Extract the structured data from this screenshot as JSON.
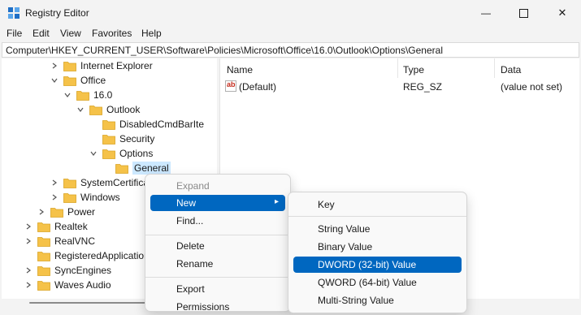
{
  "window": {
    "title": "Registry Editor",
    "minimize_glyph": "—",
    "close_glyph": "✕"
  },
  "menubar": [
    "File",
    "Edit",
    "View",
    "Favorites",
    "Help"
  ],
  "address": "Computer\\HKEY_CURRENT_USER\\Software\\Policies\\Microsoft\\Office\\16.0\\Outlook\\Options\\General",
  "tree": [
    {
      "label": "Internet Explorer",
      "expander": "collapsed"
    },
    {
      "label": "Office",
      "expander": "expanded"
    },
    {
      "label": "16.0",
      "expander": "expanded"
    },
    {
      "label": "Outlook",
      "expander": "expanded"
    },
    {
      "label": "DisabledCmdBarIte",
      "expander": "none"
    },
    {
      "label": "Security",
      "expander": "none"
    },
    {
      "label": "Options",
      "expander": "expanded"
    },
    {
      "label": "General",
      "expander": "none",
      "selected": true
    },
    {
      "label": "SystemCertificat",
      "expander": "collapsed"
    },
    {
      "label": "Windows",
      "expander": "collapsed"
    },
    {
      "label": "Power",
      "expander": "collapsed"
    },
    {
      "label": "Realtek",
      "expander": "collapsed"
    },
    {
      "label": "RealVNC",
      "expander": "collapsed"
    },
    {
      "label": "RegisteredApplication",
      "expander": "none"
    },
    {
      "label": "SyncEngines",
      "expander": "collapsed"
    },
    {
      "label": "Waves Audio",
      "expander": "collapsed"
    }
  ],
  "list": {
    "headers": {
      "name": "Name",
      "type": "Type",
      "data": "Data"
    },
    "rows": [
      {
        "icon": "string-value-icon",
        "icon_text": "ab",
        "name": "(Default)",
        "type": "REG_SZ",
        "data": "(value not set)"
      }
    ]
  },
  "context_menu": {
    "expand": "Expand",
    "new": "New",
    "find": "Find...",
    "delete": "Delete",
    "rename": "Rename",
    "export": "Export",
    "permissions": "Permissions"
  },
  "new_submenu": [
    {
      "label": "Key"
    },
    {
      "label": "String Value"
    },
    {
      "label": "Binary Value"
    },
    {
      "label": "DWORD (32-bit) Value",
      "highlighted": true
    },
    {
      "label": "QWORD (64-bit) Value"
    },
    {
      "label": "Multi-String Value"
    }
  ],
  "colors": {
    "folder": "#f5c249",
    "selection": "#cce8ff",
    "menu_highlight": "#0067c0"
  }
}
